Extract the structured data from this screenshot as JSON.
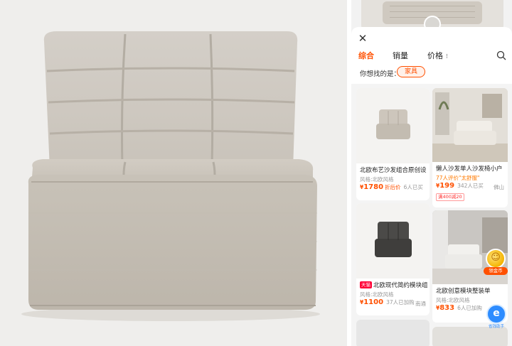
{
  "filter_tabs": [
    {
      "label": "综合",
      "active": true
    },
    {
      "label": "销量",
      "active": false
    },
    {
      "label": "价格",
      "active": false,
      "suffix": "⁝"
    }
  ],
  "suggest": {
    "label": "你想找的是：",
    "tag": "家具"
  },
  "products": [
    {
      "title": "北欧布艺沙发组合原创设",
      "attr": "风格:北欧风格",
      "price": "1780",
      "after_coupon": "折后价",
      "sold": "6人已买",
      "location": ""
    },
    {
      "title": "懒人沙发单人沙发椅小户",
      "review": "77人评价\"太舒服\"",
      "price": "199",
      "sold": "342人已买",
      "location": "佛山",
      "coupon": "满400减20"
    },
    {
      "title": "北欧现代简约模块组",
      "badge": "天猫",
      "attr": "风格:北欧风格",
      "price": "1100",
      "sold": "37人已加购",
      "location": "南通"
    },
    {
      "title": "北欧创意模块整装单",
      "attr": "风格:北欧风格",
      "price": "833",
      "sold": "6人已加购",
      "location": ""
    }
  ],
  "currency_symbol": "¥",
  "floating": {
    "coin_label": "领金币",
    "assistant_label": "省钱助手"
  },
  "colors": {
    "accent": "#ff5000",
    "price": "#ff5000",
    "tmall": "#ff0036"
  }
}
